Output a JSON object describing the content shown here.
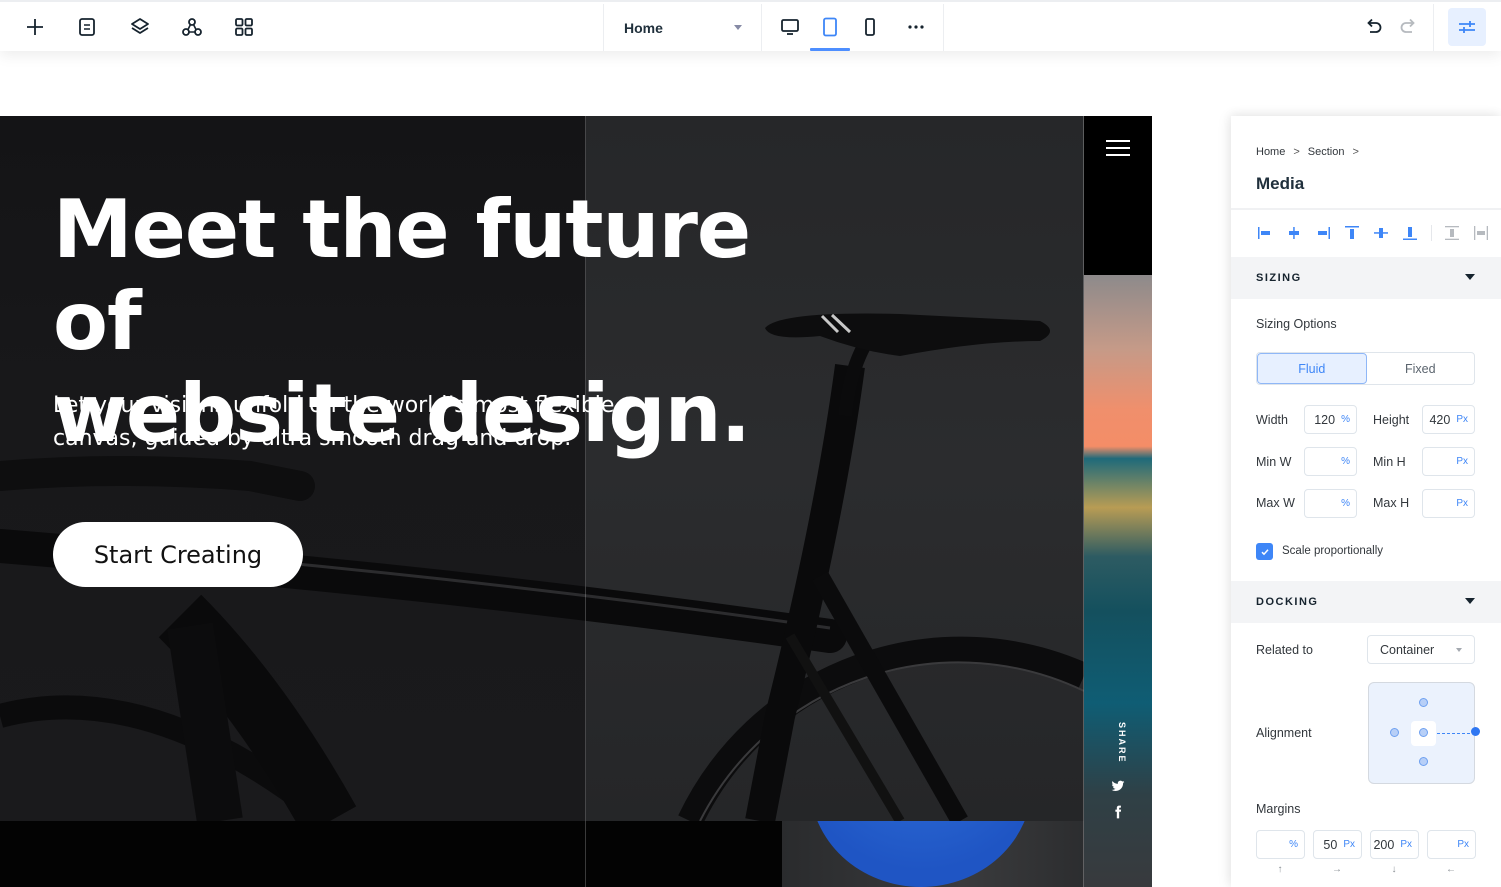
{
  "toolbar": {
    "left_icons": [
      {
        "name": "add-icon",
        "label": "Add"
      },
      {
        "name": "pages-icon",
        "label": "Pages"
      },
      {
        "name": "layers-icon",
        "label": "Layers"
      },
      {
        "name": "components-icon",
        "label": "Components"
      },
      {
        "name": "apps-grid-icon",
        "label": "Apps"
      }
    ],
    "page_select": {
      "value": "Home"
    },
    "devices": [
      {
        "name": "desktop-icon",
        "selected": false
      },
      {
        "name": "tablet-icon",
        "selected": true
      },
      {
        "name": "mobile-icon",
        "selected": false
      }
    ],
    "more_label": "···",
    "undo_enabled": true,
    "redo_enabled": false,
    "accent": "#4d8eff"
  },
  "hero": {
    "title_line1": "Meet the future of",
    "title_line2": "website design.",
    "subtitle_line1": "Let your visions unfold on the world’s most flexible",
    "subtitle_line2": "canvas, guided by ultra smooth drag and drop.",
    "cta_label": "Start Creating",
    "share_label": "SHARE",
    "social": [
      "twitter-icon",
      "facebook-icon"
    ]
  },
  "panel": {
    "breadcrumb": [
      "Home",
      "Section"
    ],
    "breadcrumb_sep": ">",
    "title": "Media",
    "sizing": {
      "header": "SIZING",
      "options_label": "Sizing Options",
      "modes": [
        "Fluid",
        "Fixed"
      ],
      "active_mode": "Fluid",
      "fields": {
        "width": {
          "label": "Width",
          "value": "120",
          "unit": "%"
        },
        "height": {
          "label": "Height",
          "value": "420",
          "unit": "Px"
        },
        "min_w": {
          "label": "Min W",
          "value": "",
          "unit": "%"
        },
        "min_h": {
          "label": "Min H",
          "value": "",
          "unit": "Px"
        },
        "max_w": {
          "label": "Max W",
          "value": "",
          "unit": "%"
        },
        "max_h": {
          "label": "Max H",
          "value": "",
          "unit": "Px"
        }
      },
      "scale_label": "Scale proportionally",
      "scale_checked": true
    },
    "docking": {
      "header": "DOCKING",
      "related_label": "Related to",
      "related_value": "Container",
      "alignment_label": "Alignment",
      "margins_label": "Margins",
      "margins": [
        {
          "value": "",
          "unit": "%",
          "arrow": "↑"
        },
        {
          "value": "50",
          "unit": "Px",
          "arrow": "→"
        },
        {
          "value": "200",
          "unit": "Px",
          "arrow": "↓"
        },
        {
          "value": "",
          "unit": "Px",
          "arrow": "←"
        }
      ]
    }
  }
}
